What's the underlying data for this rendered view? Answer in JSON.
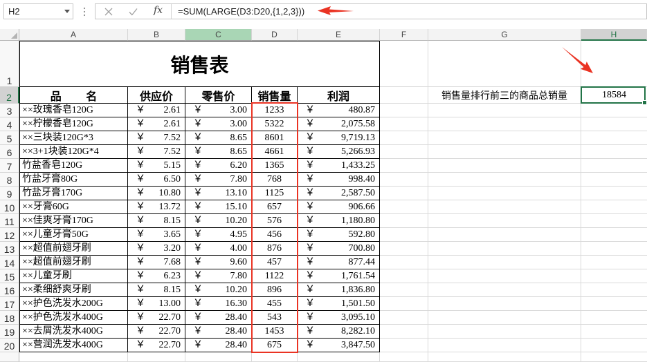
{
  "formula_bar": {
    "name_box": "H2",
    "insert_function_label": "fx",
    "formula": "=SUM(LARGE(D3:D20,{1,2,3}))"
  },
  "icons": {
    "name_box_dropdown": "chevron-down-icon",
    "formula_bar_options": "vertical-dots-icon",
    "cancel": "cancel-icon",
    "enter": "check-icon",
    "insert_function": "function-icon",
    "select_all": "select-all-triangle-icon",
    "fill_handle": "fill-handle-icon",
    "annotation": "arrow-icon"
  },
  "columns": [
    "A",
    "B",
    "C",
    "D",
    "E",
    "F",
    "G",
    "H"
  ],
  "row_numbers": [
    "1",
    "2",
    "3",
    "4",
    "5",
    "6",
    "7",
    "8",
    "9",
    "10",
    "11",
    "12",
    "13",
    "14",
    "15",
    "16",
    "17",
    "18",
    "19",
    "20"
  ],
  "sheet": {
    "title": "销售表",
    "headers": [
      "品 名",
      "供应价",
      "零售价",
      "销售量",
      "利润"
    ],
    "currency_symbol": "￥",
    "rows": [
      {
        "name": "××玫瑰香皂120G",
        "supply": "2.61",
        "retail": "3.00",
        "sales": "1233",
        "profit": "480.87"
      },
      {
        "name": "××柠檬香皂120G",
        "supply": "2.61",
        "retail": "3.00",
        "sales": "5322",
        "profit": "2,075.58"
      },
      {
        "name": "××三块装120G*3",
        "supply": "7.52",
        "retail": "8.65",
        "sales": "8601",
        "profit": "9,719.13"
      },
      {
        "name": "××3+1块装120G*4",
        "supply": "7.52",
        "retail": "8.65",
        "sales": "4661",
        "profit": "5,266.93"
      },
      {
        "name": "竹盐香皂120G",
        "supply": "5.15",
        "retail": "6.20",
        "sales": "1365",
        "profit": "1,433.25"
      },
      {
        "name": "竹盐牙膏80G",
        "supply": "6.50",
        "retail": "7.80",
        "sales": "768",
        "profit": "998.40"
      },
      {
        "name": "竹盐牙膏170G",
        "supply": "10.80",
        "retail": "13.10",
        "sales": "1125",
        "profit": "2,587.50"
      },
      {
        "name": "××牙膏60G",
        "supply": "13.72",
        "retail": "15.10",
        "sales": "657",
        "profit": "906.66"
      },
      {
        "name": "××佳爽牙膏170G",
        "supply": "8.15",
        "retail": "10.20",
        "sales": "576",
        "profit": "1,180.80"
      },
      {
        "name": "××儿童牙膏50G",
        "supply": "3.65",
        "retail": "4.95",
        "sales": "456",
        "profit": "592.80"
      },
      {
        "name": "××超值前翅牙刷",
        "supply": "3.20",
        "retail": "4.00",
        "sales": "876",
        "profit": "700.80"
      },
      {
        "name": "××超值前翅牙刷",
        "supply": "7.68",
        "retail": "9.60",
        "sales": "457",
        "profit": "877.44"
      },
      {
        "name": "××儿童牙刷",
        "supply": "6.23",
        "retail": "7.80",
        "sales": "1122",
        "profit": "1,761.54"
      },
      {
        "name": "××柔细舒爽牙刷",
        "supply": "8.15",
        "retail": "10.20",
        "sales": "896",
        "profit": "1,836.80"
      },
      {
        "name": "××护色洗发水200G",
        "supply": "13.00",
        "retail": "16.30",
        "sales": "455",
        "profit": "1,501.50"
      },
      {
        "name": "××护色洗发水400G",
        "supply": "22.70",
        "retail": "28.40",
        "sales": "543",
        "profit": "3,095.10"
      },
      {
        "name": "××去屑洗发水400G",
        "supply": "22.70",
        "retail": "28.40",
        "sales": "1453",
        "profit": "8,282.10"
      },
      {
        "name": "××营润洗发水400G",
        "supply": "22.70",
        "retail": "28.40",
        "sales": "675",
        "profit": "3,847.50"
      }
    ],
    "summary_label": "销售量排行前三的商品总销量",
    "summary_value": "18584"
  },
  "colors": {
    "accent_green": "#217346",
    "annotation_red": "#ea3323",
    "column_c_header": "#a9d6b5",
    "table_border": "#000000",
    "gridline": "#d9d9d9"
  }
}
